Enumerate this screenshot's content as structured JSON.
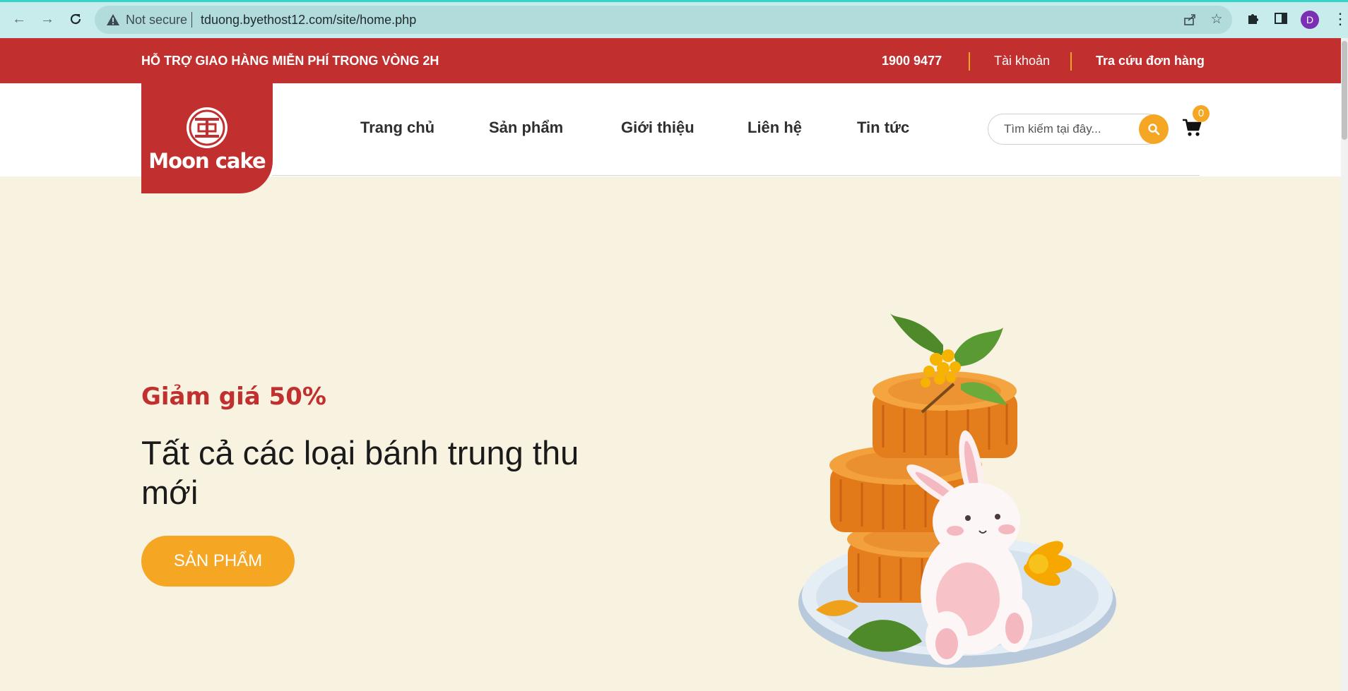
{
  "browser": {
    "security_label": "Not secure",
    "url": "tduong.byethost12.com/site/home.php",
    "profile_initial": "D"
  },
  "topbar": {
    "promo": "HỖ TRỢ GIAO HÀNG MIỄN PHÍ TRONG VÒNG 2H",
    "phone": "1900 9477",
    "account": "Tài khoản",
    "order_lookup": "Tra cứu đơn hàng"
  },
  "logo": {
    "text": "Moon cake"
  },
  "nav": {
    "items": [
      {
        "label": "Trang chủ"
      },
      {
        "label": "Sản phẩm"
      },
      {
        "label": "Giới thiệu"
      },
      {
        "label": "Liên hệ"
      },
      {
        "label": "Tin tức"
      }
    ]
  },
  "search": {
    "placeholder": "Tìm kiếm tại đây..."
  },
  "cart": {
    "count": "0"
  },
  "hero": {
    "promo": "Giảm giá 50%",
    "headline": "Tất cả các loại bánh trung thu mới",
    "cta": "SẢN PHẨM"
  },
  "colors": {
    "brand_red": "#c1302e",
    "accent_orange": "#f5a623",
    "hero_bg": "#f8f2e0"
  }
}
